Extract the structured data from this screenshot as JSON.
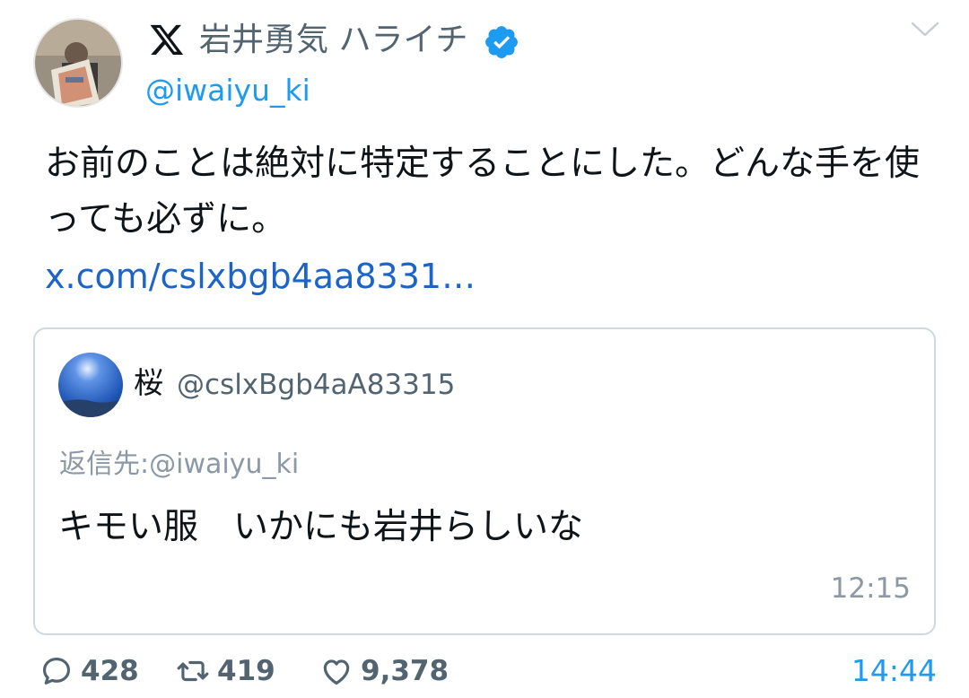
{
  "author": {
    "display_name": "岩井勇気 ハライチ",
    "handle": "@iwaiyu_ki",
    "avatar": "profile-photo",
    "verified": true
  },
  "tweet": {
    "text": "お前のことは絶対に特定することにした。どんな手を使っても必ずに。",
    "link": "x.com/cslxbgb4aa8331…"
  },
  "quote": {
    "name": "桜",
    "handle": "@cslxBgb4aA83315",
    "reply_to": "返信先:@iwaiyu_ki",
    "text": "キモい服　いかにも岩井らしいな",
    "time": "12:15"
  },
  "stats": {
    "replies": "428",
    "retweets": "419",
    "likes": "9,378"
  },
  "time": "14:44",
  "colors": {
    "accent": "#1d9bf0",
    "link": "#1d64c8",
    "muted": "#536471",
    "border": "#cfd9de"
  },
  "icons": {
    "app": "x-logo-icon",
    "verified": "verified-badge-icon",
    "menu": "chevron-down-icon",
    "reply": "comment-icon",
    "retweet": "retweet-icon",
    "like": "heart-icon"
  }
}
